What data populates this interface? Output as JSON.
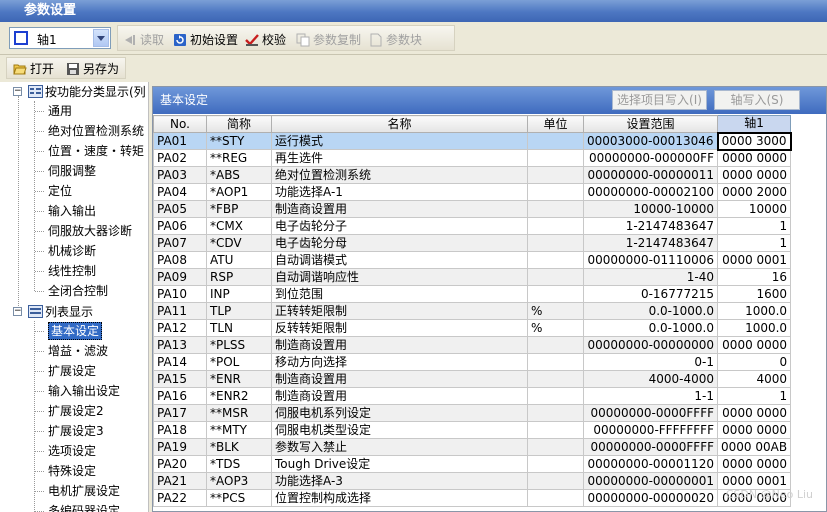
{
  "window": {
    "title": "参数设置"
  },
  "toolbar": {
    "axis_selector": "轴1",
    "read": "读取",
    "initial_settings": "初始设置",
    "verify": "校验",
    "param_copy": "参数复制",
    "param_block": "参数块",
    "open": "打开",
    "save_as": "另存为"
  },
  "tree": {
    "group_function": "按功能分类显示(列",
    "function_items": [
      "通用",
      "绝对位置检测系统",
      "位置・速度・转矩",
      "伺服调整",
      "定位",
      "输入输出",
      "伺服放大器诊断",
      "机械诊断",
      "线性控制",
      "全闭合控制"
    ],
    "group_list": "列表显示",
    "list_items": [
      "基本设定",
      "增益・滤波",
      "扩展设定",
      "输入输出设定",
      "扩展设定2",
      "扩展设定3",
      "选项设定",
      "特殊设定",
      "电机扩展设定",
      "多编码器设定"
    ]
  },
  "panel": {
    "title": "基本设定",
    "write_selected": "选择项目写入(I)",
    "axis_write": "轴写入(S)"
  },
  "table": {
    "headers": [
      "No.",
      "简称",
      "名称",
      "单位",
      "设置范围",
      "轴1"
    ],
    "rows": [
      [
        "PA01",
        "**STY",
        "运行模式",
        "",
        "00003000-00013046",
        "0000 3000"
      ],
      [
        "PA02",
        "**REG",
        "再生选件",
        "",
        "00000000-000000FF",
        "0000 0000"
      ],
      [
        "PA03",
        "*ABS",
        "绝对位置检测系统",
        "",
        "00000000-00000011",
        "0000 0000"
      ],
      [
        "PA04",
        "*AOP1",
        "功能选择A-1",
        "",
        "00000000-00002100",
        "0000 2000"
      ],
      [
        "PA05",
        "*FBP",
        "制造商设置用",
        "",
        "10000-10000",
        "10000"
      ],
      [
        "PA06",
        "*CMX",
        "电子齿轮分子",
        "",
        "1-2147483647",
        "1"
      ],
      [
        "PA07",
        "*CDV",
        "电子齿轮分母",
        "",
        "1-2147483647",
        "1"
      ],
      [
        "PA08",
        "ATU",
        "自动调谐模式",
        "",
        "00000000-01110006",
        "0000 0001"
      ],
      [
        "PA09",
        "RSP",
        "自动调谐响应性",
        "",
        "1-40",
        "16"
      ],
      [
        "PA10",
        "INP",
        "到位范围",
        "",
        "0-16777215",
        "1600"
      ],
      [
        "PA11",
        "TLP",
        "正转转矩限制",
        "%",
        "0.0-1000.0",
        "1000.0"
      ],
      [
        "PA12",
        "TLN",
        "反转转矩限制",
        "%",
        "0.0-1000.0",
        "1000.0"
      ],
      [
        "PA13",
        "*PLSS",
        "制造商设置用",
        "",
        "00000000-00000000",
        "0000 0000"
      ],
      [
        "PA14",
        "*POL",
        "移动方向选择",
        "",
        "0-1",
        "0"
      ],
      [
        "PA15",
        "*ENR",
        "制造商设置用",
        "",
        "4000-4000",
        "4000"
      ],
      [
        "PA16",
        "*ENR2",
        "制造商设置用",
        "",
        "1-1",
        "1"
      ],
      [
        "PA17",
        "**MSR",
        "伺服电机系列设定",
        "",
        "00000000-0000FFFF",
        "0000 0000"
      ],
      [
        "PA18",
        "**MTY",
        "伺服电机类型设定",
        "",
        "00000000-FFFFFFFF",
        "0000 0000"
      ],
      [
        "PA19",
        "*BLK",
        "参数写入禁止",
        "",
        "00000000-0000FFFF",
        "0000 00AB"
      ],
      [
        "PA20",
        "*TDS",
        "Tough Drive设定",
        "",
        "00000000-00001120",
        "0000 0000"
      ],
      [
        "PA21",
        "*AOP3",
        "功能选择A-3",
        "",
        "00000000-00000001",
        "0000 0001"
      ],
      [
        "PA22",
        "**PCS",
        "位置控制构成选择",
        "",
        "00000000-00000020",
        "0000 0000"
      ]
    ]
  },
  "watermark": "CSDN @Neo Liu"
}
